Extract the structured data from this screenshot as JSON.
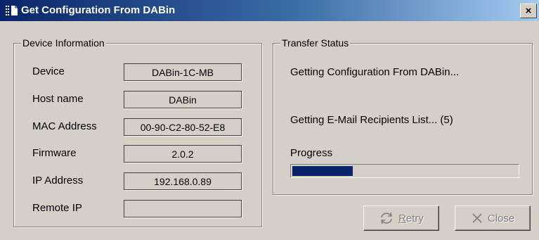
{
  "window": {
    "title": "Get Configuration From DABin",
    "close_glyph": "×"
  },
  "device_info": {
    "group_title": "Device Information",
    "fields": [
      {
        "label": "Device",
        "value": "DABin-1C-MB"
      },
      {
        "label": "Host name",
        "value": "DABin"
      },
      {
        "label": "MAC Address",
        "value": "00-90-C2-80-52-E8"
      },
      {
        "label": "Firmware",
        "value": "2.0.2"
      },
      {
        "label": "IP Address",
        "value": "192.168.0.89"
      },
      {
        "label": "Remote IP",
        "value": ""
      }
    ]
  },
  "transfer": {
    "group_title": "Transfer Status",
    "status_line_1": "Getting Configuration From DABin...",
    "status_line_2": "Getting E-Mail Recipients List... (5)",
    "progress_label": "Progress",
    "progress_fraction": 0.27
  },
  "buttons": {
    "retry": {
      "prefix": "",
      "mnemonic": "R",
      "rest": "etry",
      "enabled": false,
      "icon": "retry-icon"
    },
    "close": {
      "label": "Close",
      "enabled": false,
      "icon": "close-x-icon"
    }
  },
  "colors": {
    "title_bar_start": "#0a246a",
    "title_bar_end": "#a6caf0",
    "progress_fill": "#0a246a",
    "window_bg": "#d4d0c8"
  }
}
